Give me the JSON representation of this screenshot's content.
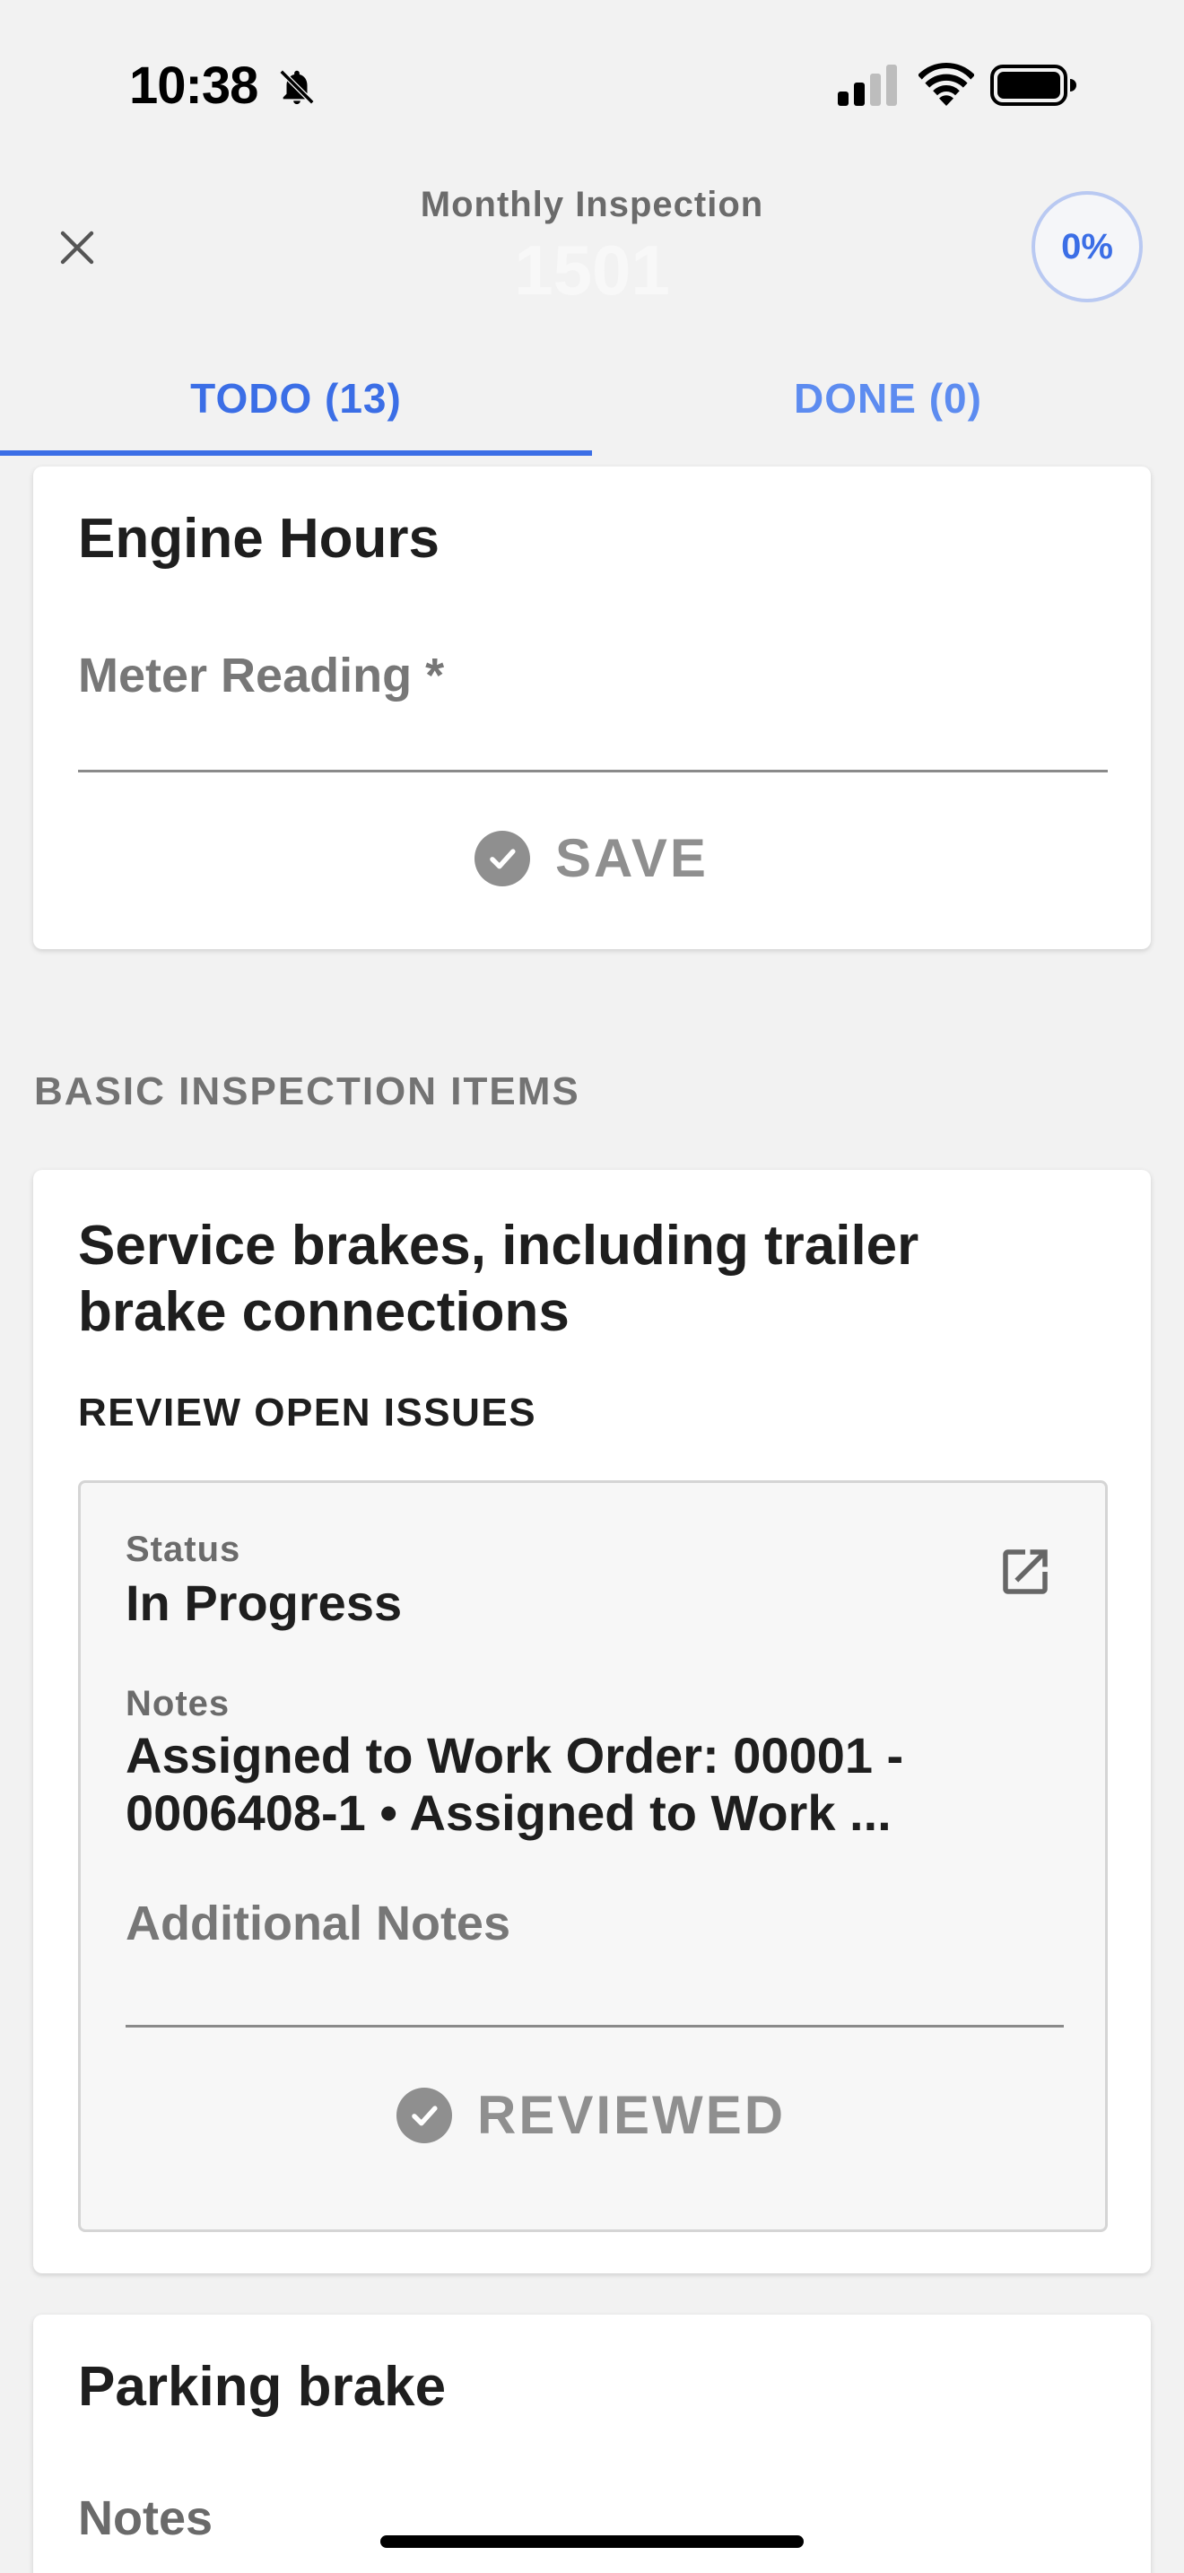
{
  "status_bar": {
    "time": "10:38",
    "icons": [
      "bell-slash-icon",
      "cellular-signal-icon",
      "wifi-icon",
      "battery-icon"
    ]
  },
  "header": {
    "title": "Monthly Inspection",
    "subtitle": "1501",
    "progress": "0%",
    "close_icon": "close-icon"
  },
  "tabs": [
    {
      "label": "TODO (13)",
      "active": true
    },
    {
      "label": "DONE (0)",
      "active": false
    }
  ],
  "engine_card": {
    "title": "Engine Hours",
    "field_label": "Meter Reading *",
    "save_label": "SAVE"
  },
  "section": {
    "heading": "BASIC INSPECTION ITEMS"
  },
  "brakes_card": {
    "title_line1": "Service brakes, including trailer",
    "title_line2": "brake connections",
    "review_heading": "REVIEW OPEN ISSUES",
    "issue": {
      "status_label": "Status",
      "status_value": "In Progress",
      "notes_label": "Notes",
      "notes_line1": "Assigned to Work Order: 00001 -",
      "notes_line2": "0006408-1 • Assigned to Work ...",
      "additional_notes_label": "Additional Notes",
      "reviewed_label": "REVIEWED"
    }
  },
  "parking_card": {
    "title": "Parking brake",
    "notes_label": "Notes"
  },
  "colors": {
    "accent": "#3b6ee6",
    "muted": "#8f8f8f",
    "background": "#f2f2f2"
  }
}
